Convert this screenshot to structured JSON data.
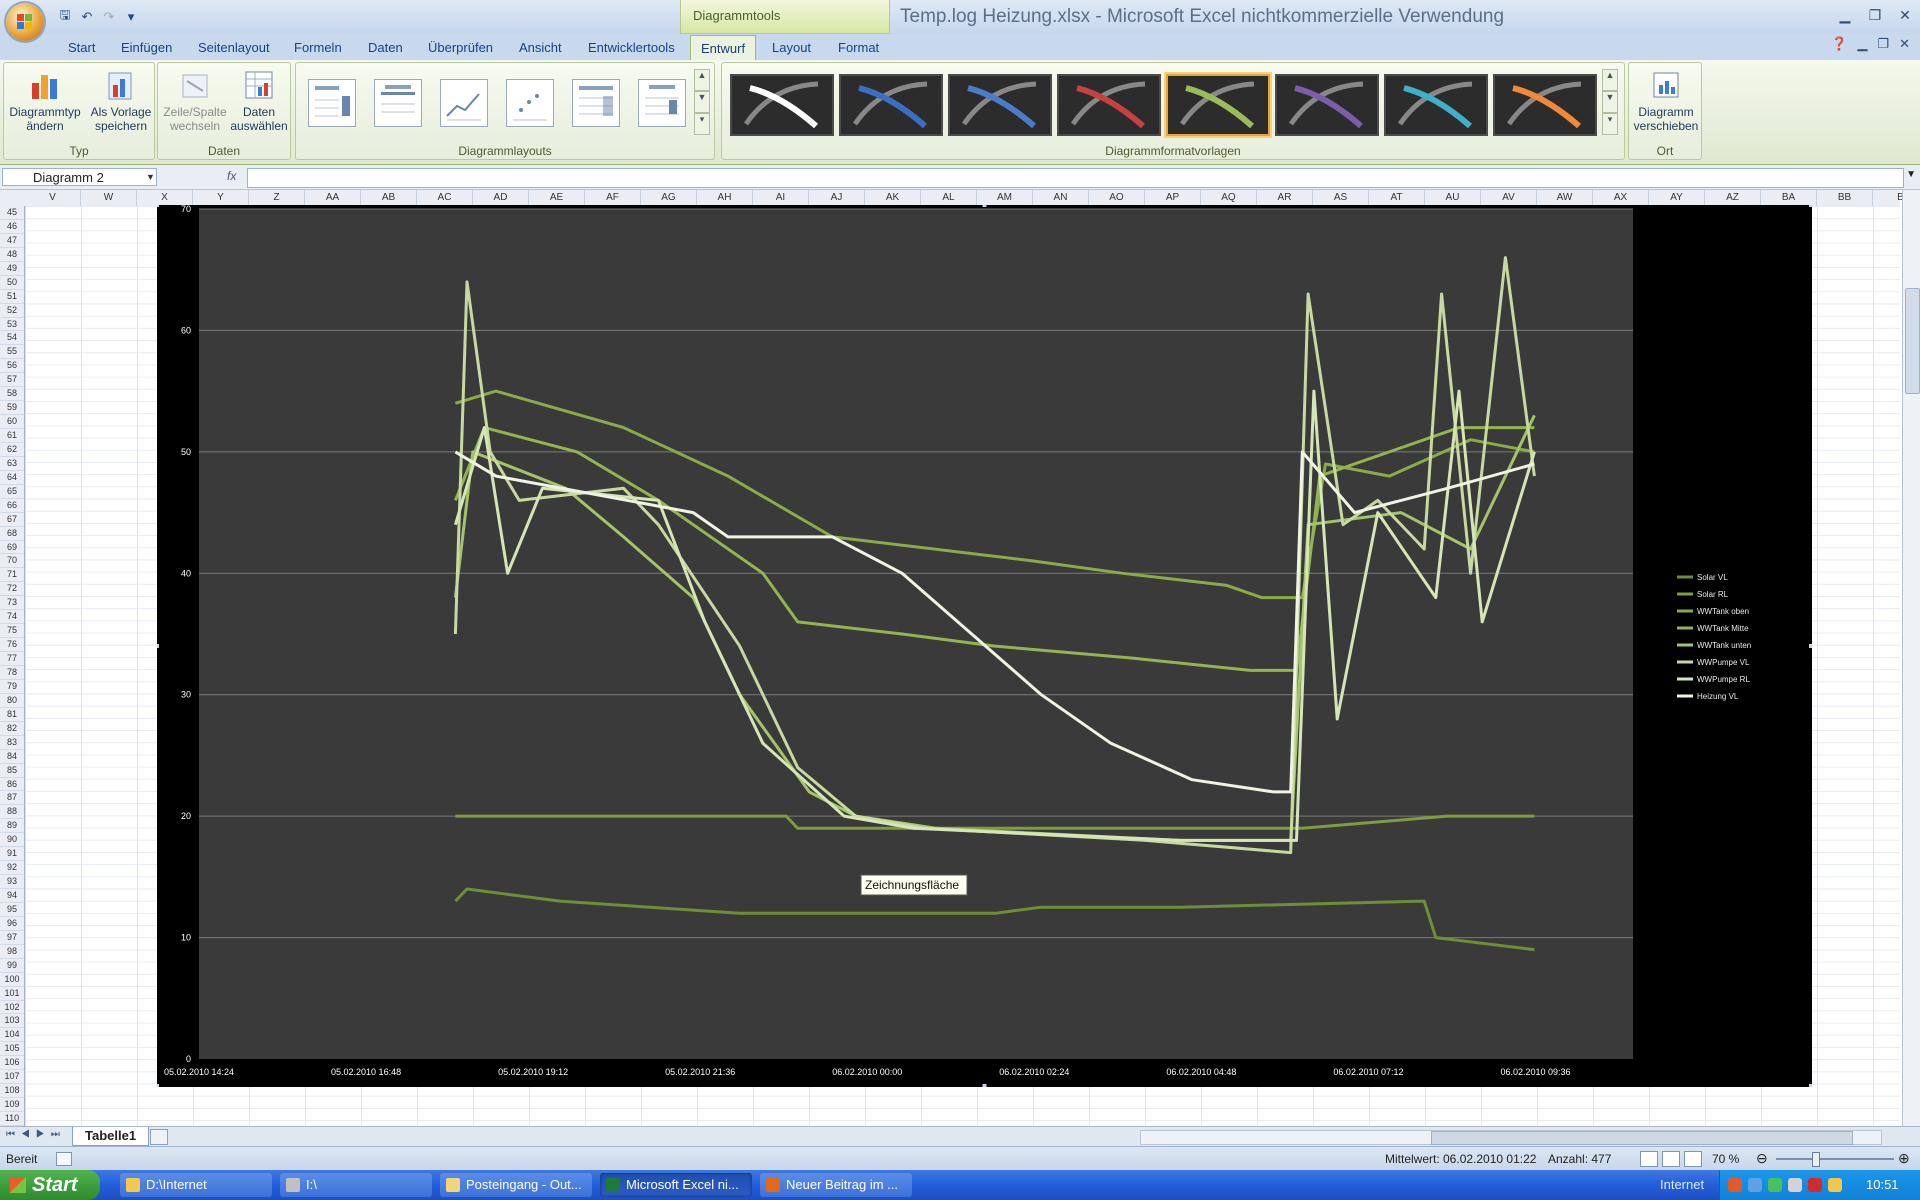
{
  "window": {
    "title": "Temp.log Heizung.xlsx - Microsoft Excel nichtkommerzielle Verwendung",
    "contextual_tab_group": "Diagrammtools"
  },
  "ribbon": {
    "tabs": [
      "Start",
      "Einfügen",
      "Seitenlayout",
      "Formeln",
      "Daten",
      "Überprüfen",
      "Ansicht",
      "Entwicklertools",
      "Entwurf",
      "Layout",
      "Format"
    ],
    "active_tab": "Entwurf",
    "groups": {
      "typ": {
        "label": "Typ",
        "btn1_line1": "Diagrammtyp",
        "btn1_line2": "ändern",
        "btn2_line1": "Als Vorlage",
        "btn2_line2": "speichern"
      },
      "daten": {
        "label": "Daten",
        "btn1_line1": "Zeile/Spalte",
        "btn1_line2": "wechseln",
        "btn2_line1": "Daten",
        "btn2_line2": "auswählen"
      },
      "layouts": {
        "label": "Diagrammlayouts"
      },
      "styles": {
        "label": "Diagrammformatvorlagen",
        "colors": [
          "#ffffff",
          "#3a6fc4",
          "#4a7cc8",
          "#c84040",
          "#9bbb59",
          "#7b5ea7",
          "#3fb0c9",
          "#f08a3a"
        ],
        "selected_index": 4
      },
      "ort": {
        "label": "Ort",
        "btn_line1": "Diagramm",
        "btn_line2": "verschieben"
      }
    }
  },
  "formula_bar": {
    "name_box": "Diagramm 2",
    "fx": "fx",
    "value": ""
  },
  "sheet": {
    "columns": [
      "V",
      "W",
      "X",
      "Y",
      "Z",
      "AA",
      "AB",
      "AC",
      "AD",
      "AE",
      "AF",
      "AG",
      "AH",
      "AI",
      "AJ",
      "AK",
      "AL",
      "AM",
      "AN",
      "AO",
      "AP",
      "AQ",
      "AR",
      "AS",
      "AT",
      "AU",
      "AV",
      "AW",
      "AX",
      "AY",
      "AZ",
      "BA",
      "BB",
      "B"
    ],
    "first_row": 45,
    "last_row": 110,
    "sheet_tab": "Tabelle1"
  },
  "chart_data": {
    "type": "line",
    "title": "",
    "xlabel": "",
    "ylabel": "",
    "ylim": [
      0,
      70
    ],
    "yticks": [
      0,
      10,
      20,
      30,
      40,
      50,
      60,
      70
    ],
    "xticks": [
      "05.02.2010 14:24",
      "05.02.2010 16:48",
      "05.02.2010 19:12",
      "05.02.2010 21:36",
      "06.02.2010 00:00",
      "06.02.2010 02:24",
      "06.02.2010 04:48",
      "06.02.2010 07:12",
      "06.02.2010 09:36"
    ],
    "xlim": [
      "05.02.2010 14:24",
      "06.02.2010 11:00"
    ],
    "grid": "horizontal",
    "legend_position": "right",
    "tooltip": "Zeichnungsfläche",
    "background": "#3a3a3a",
    "series": [
      {
        "name": "Solar VL",
        "color": "#6f8f35",
        "points": [
          [
            "05.02.2010 18:05",
            13
          ],
          [
            "05.02.2010 18:15",
            14
          ],
          [
            "05.02.2010 19:35",
            13
          ],
          [
            "05.02.2010 22:10",
            12
          ],
          [
            "06.02.2010 01:50",
            12
          ],
          [
            "06.02.2010 02:30",
            12.5
          ],
          [
            "06.02.2010 04:30",
            12.5
          ],
          [
            "06.02.2010 08:00",
            13
          ],
          [
            "06.02.2010 08:10",
            10
          ],
          [
            "06.02.2010 09:35",
            9
          ]
        ]
      },
      {
        "name": "Solar RL",
        "color": "#7e9d3f",
        "points": [
          [
            "05.02.2010 18:05",
            20
          ],
          [
            "05.02.2010 22:50",
            20
          ],
          [
            "05.02.2010 23:00",
            19
          ],
          [
            "06.02.2010 06:15",
            19
          ],
          [
            "06.02.2010 08:20",
            20
          ],
          [
            "06.02.2010 09:35",
            20
          ]
        ]
      },
      {
        "name": "WWTank oben",
        "color": "#8aab48",
        "points": [
          [
            "05.02.2010 18:05",
            54
          ],
          [
            "05.02.2010 18:40",
            55
          ],
          [
            "05.02.2010 20:30",
            52
          ],
          [
            "05.02.2010 22:00",
            48
          ],
          [
            "05.02.2010 23:30",
            43
          ],
          [
            "06.02.2010 02:24",
            41
          ],
          [
            "06.02.2010 03:40",
            40
          ],
          [
            "06.02.2010 05:10",
            39
          ],
          [
            "06.02.2010 05:40",
            38
          ],
          [
            "06.02.2010 06:15",
            38
          ],
          [
            "06.02.2010 06:35",
            49
          ],
          [
            "06.02.2010 07:30",
            48
          ],
          [
            "06.02.2010 08:40",
            51
          ],
          [
            "06.02.2010 09:35",
            50
          ]
        ]
      },
      {
        "name": "WWTank Mitte",
        "color": "#93b451",
        "points": [
          [
            "05.02.2010 18:05",
            46
          ],
          [
            "05.02.2010 18:30",
            52
          ],
          [
            "05.02.2010 19:50",
            50
          ],
          [
            "05.02.2010 21:00",
            46
          ],
          [
            "05.02.2010 22:30",
            40
          ],
          [
            "05.02.2010 23:00",
            36
          ],
          [
            "06.02.2010 00:30",
            35
          ],
          [
            "06.02.2010 01:50",
            34
          ],
          [
            "06.02.2010 03:50",
            33
          ],
          [
            "06.02.2010 05:30",
            32
          ],
          [
            "06.02.2010 06:10",
            32
          ],
          [
            "06.02.2010 06:30",
            48
          ],
          [
            "06.02.2010 08:30",
            52
          ],
          [
            "06.02.2010 09:35",
            52
          ]
        ]
      },
      {
        "name": "WWTank unten",
        "color": "#a5c46a",
        "points": [
          [
            "05.02.2010 18:05",
            38
          ],
          [
            "05.02.2010 18:20",
            50
          ],
          [
            "05.02.2010 19:40",
            47
          ],
          [
            "05.02.2010 20:30",
            43
          ],
          [
            "05.02.2010 21:30",
            38
          ],
          [
            "05.02.2010 22:10",
            30
          ],
          [
            "05.02.2010 23:10",
            22
          ],
          [
            "05.02.2010 23:50",
            20
          ],
          [
            "06.02.2010 01:00",
            19
          ],
          [
            "06.02.2010 04:30",
            18
          ],
          [
            "06.02.2010 06:05",
            18
          ],
          [
            "06.02.2010 06:20",
            44
          ],
          [
            "06.02.2010 07:40",
            45
          ],
          [
            "06.02.2010 08:40",
            42
          ],
          [
            "06.02.2010 09:35",
            53
          ]
        ]
      },
      {
        "name": "WWPumpe VL",
        "color": "#c7d9a0",
        "points": [
          [
            "05.02.2010 18:05",
            35
          ],
          [
            "05.02.2010 18:15",
            64
          ],
          [
            "05.02.2010 18:35",
            50
          ],
          [
            "05.02.2010 19:00",
            46
          ],
          [
            "05.02.2010 20:30",
            47
          ],
          [
            "05.02.2010 21:00",
            44
          ],
          [
            "05.02.2010 22:10",
            34
          ],
          [
            "05.02.2010 23:00",
            24
          ],
          [
            "05.02.2010 23:50",
            20
          ],
          [
            "06.02.2010 00:50",
            19
          ],
          [
            "06.02.2010 04:00",
            18
          ],
          [
            "06.02.2010 06:05",
            17
          ],
          [
            "06.02.2010 06:20",
            63
          ],
          [
            "06.02.2010 06:50",
            44
          ],
          [
            "06.02.2010 07:20",
            46
          ],
          [
            "06.02.2010 08:00",
            42
          ],
          [
            "06.02.2010 08:15",
            63
          ],
          [
            "06.02.2010 08:40",
            40
          ],
          [
            "06.02.2010 09:10",
            66
          ],
          [
            "06.02.2010 09:35",
            48
          ]
        ]
      },
      {
        "name": "WWPumpe RL",
        "color": "#d6e5b6",
        "points": [
          [
            "05.02.2010 18:05",
            44
          ],
          [
            "05.02.2010 18:30",
            52
          ],
          [
            "05.02.2010 18:50",
            40
          ],
          [
            "05.02.2010 19:20",
            47
          ],
          [
            "05.02.2010 21:00",
            46
          ],
          [
            "05.02.2010 21:40",
            36
          ],
          [
            "05.02.2010 22:30",
            26
          ],
          [
            "05.02.2010 23:40",
            20
          ],
          [
            "06.02.2010 00:40",
            19
          ],
          [
            "06.02.2010 04:30",
            18
          ],
          [
            "06.02.2010 06:10",
            18
          ],
          [
            "06.02.2010 06:25",
            55
          ],
          [
            "06.02.2010 06:45",
            28
          ],
          [
            "06.02.2010 07:20",
            45
          ],
          [
            "06.02.2010 08:10",
            38
          ],
          [
            "06.02.2010 08:30",
            55
          ],
          [
            "06.02.2010 08:50",
            36
          ],
          [
            "06.02.2010 09:35",
            50
          ]
        ]
      },
      {
        "name": "Heizung VL",
        "color": "#eef3e2",
        "points": [
          [
            "05.02.2010 18:05",
            50
          ],
          [
            "05.02.2010 18:40",
            48
          ],
          [
            "05.02.2010 21:30",
            45
          ],
          [
            "05.02.2010 22:00",
            43
          ],
          [
            "05.02.2010 23:30",
            43
          ],
          [
            "06.02.2010 00:30",
            40
          ],
          [
            "06.02.2010 01:30",
            35
          ],
          [
            "06.02.2010 02:30",
            30
          ],
          [
            "06.02.2010 03:30",
            26
          ],
          [
            "06.02.2010 04:40",
            23
          ],
          [
            "06.02.2010 05:50",
            22
          ],
          [
            "06.02.2010 06:05",
            22
          ],
          [
            "06.02.2010 06:15",
            50
          ],
          [
            "06.02.2010 07:00",
            45
          ],
          [
            "06.02.2010 08:20",
            47
          ],
          [
            "06.02.2010 09:35",
            49
          ]
        ]
      }
    ]
  },
  "status_bar": {
    "ready": "Bereit",
    "average": "Mittelwert: 06.02.2010 01:22",
    "count": "Anzahl: 477",
    "zoom": "70 %"
  },
  "taskbar": {
    "start": "Start",
    "tasks": [
      {
        "label": "D:\\Internet",
        "color": "#f3c84c"
      },
      {
        "label": "I:\\",
        "color": "#c0c0c0"
      },
      {
        "label": "Posteingang - Out...",
        "color": "#f2d57a"
      },
      {
        "label": "Microsoft Excel ni...",
        "color": "#1f7a3a"
      },
      {
        "label": "Neuer Beitrag im ...",
        "color": "#e06a1b"
      }
    ],
    "tray_text": "Internet",
    "clock": "10:51"
  }
}
